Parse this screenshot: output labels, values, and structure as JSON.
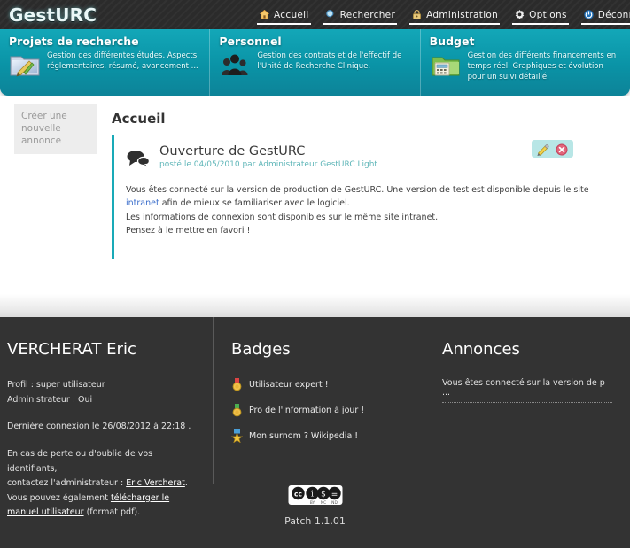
{
  "header": {
    "logo": "GestURC",
    "nav": [
      {
        "label": "Accueil",
        "icon": "home-icon"
      },
      {
        "label": "Rechercher",
        "icon": "magnifier-icon"
      },
      {
        "label": "Administration",
        "icon": "lock-icon"
      },
      {
        "label": "Options",
        "icon": "gear-icon"
      },
      {
        "label": "Déconnexion",
        "icon": "power-icon"
      }
    ]
  },
  "banner": {
    "columns": [
      {
        "title": "Projets de recherche",
        "text": "Gestion des différentes études. Aspects réglementaires, résumé, avancement ...",
        "icon": "folder-pencil-icon"
      },
      {
        "title": "Personnel",
        "text": "Gestion des contrats et de l'effectif de l'Unité de Recherche Clinique.",
        "icon": "people-icon"
      },
      {
        "title": "Budget",
        "text": "Gestion des différents financements en temps réel. Graphiques et évolution pour un suivi détaillé.",
        "icon": "folder-calculator-icon"
      }
    ]
  },
  "main": {
    "create_button": "Créer une nouvelle annonce",
    "page_title": "Accueil",
    "announcement": {
      "title": "Ouverture de GestURC",
      "meta": "posté le 04/05/2010 par Administrateur GestURC Light",
      "body_line1_pre": "Vous êtes connecté sur la version de production de GestURC. Une version de test est disponible depuis le site ",
      "body_link": "intranet",
      "body_line1_post": " afin de mieux se familiariser avec le logiciel.",
      "body_line2": "Les informations de connexion sont disponibles sur le même site intranet.",
      "body_line3": "Pensez à le mettre en favori !",
      "edit_label": "pencil-icon",
      "delete_label": "delete-icon"
    }
  },
  "footer": {
    "user": {
      "name": "VERCHERAT Eric",
      "profil": "Profil : super utilisateur",
      "administrateur": "Administrateur : Oui",
      "last_connection": "Dernière connexion le 26/08/2012 à 22:18 .",
      "help_line1": "En cas de perte ou d'oublie de vos identifiants,",
      "help_line2_pre": "contactez l'administrateur : ",
      "help_admin_link": "Eric Vercherat",
      "help_line2_post": ".",
      "help_line3_pre": "Vous pouvez également ",
      "help_manual_link": "télécharger le manuel utilisateur",
      "help_line3_post": " (format pdf)."
    },
    "badges": {
      "title": "Badges",
      "items": [
        {
          "label": "Utilisateur expert !",
          "icon": "medal-red-icon"
        },
        {
          "label": "Pro de l'information à jour !",
          "icon": "medal-green-icon"
        },
        {
          "label": "Mon surnom ? Wikipedia !",
          "icon": "star-badge-icon"
        }
      ]
    },
    "annonces": {
      "title": "Annonces",
      "items": [
        "Vous êtes connecté sur la version de p ..."
      ]
    },
    "license_icon": "creative-commons-by-nc-nd-icon",
    "patch": "Patch 1.1.01"
  },
  "colors": {
    "teal": "#0d93a6",
    "dark": "#2b2b2b",
    "footer": "#333333",
    "link": "#3b6ecb",
    "meta": "#5fb6b8"
  }
}
